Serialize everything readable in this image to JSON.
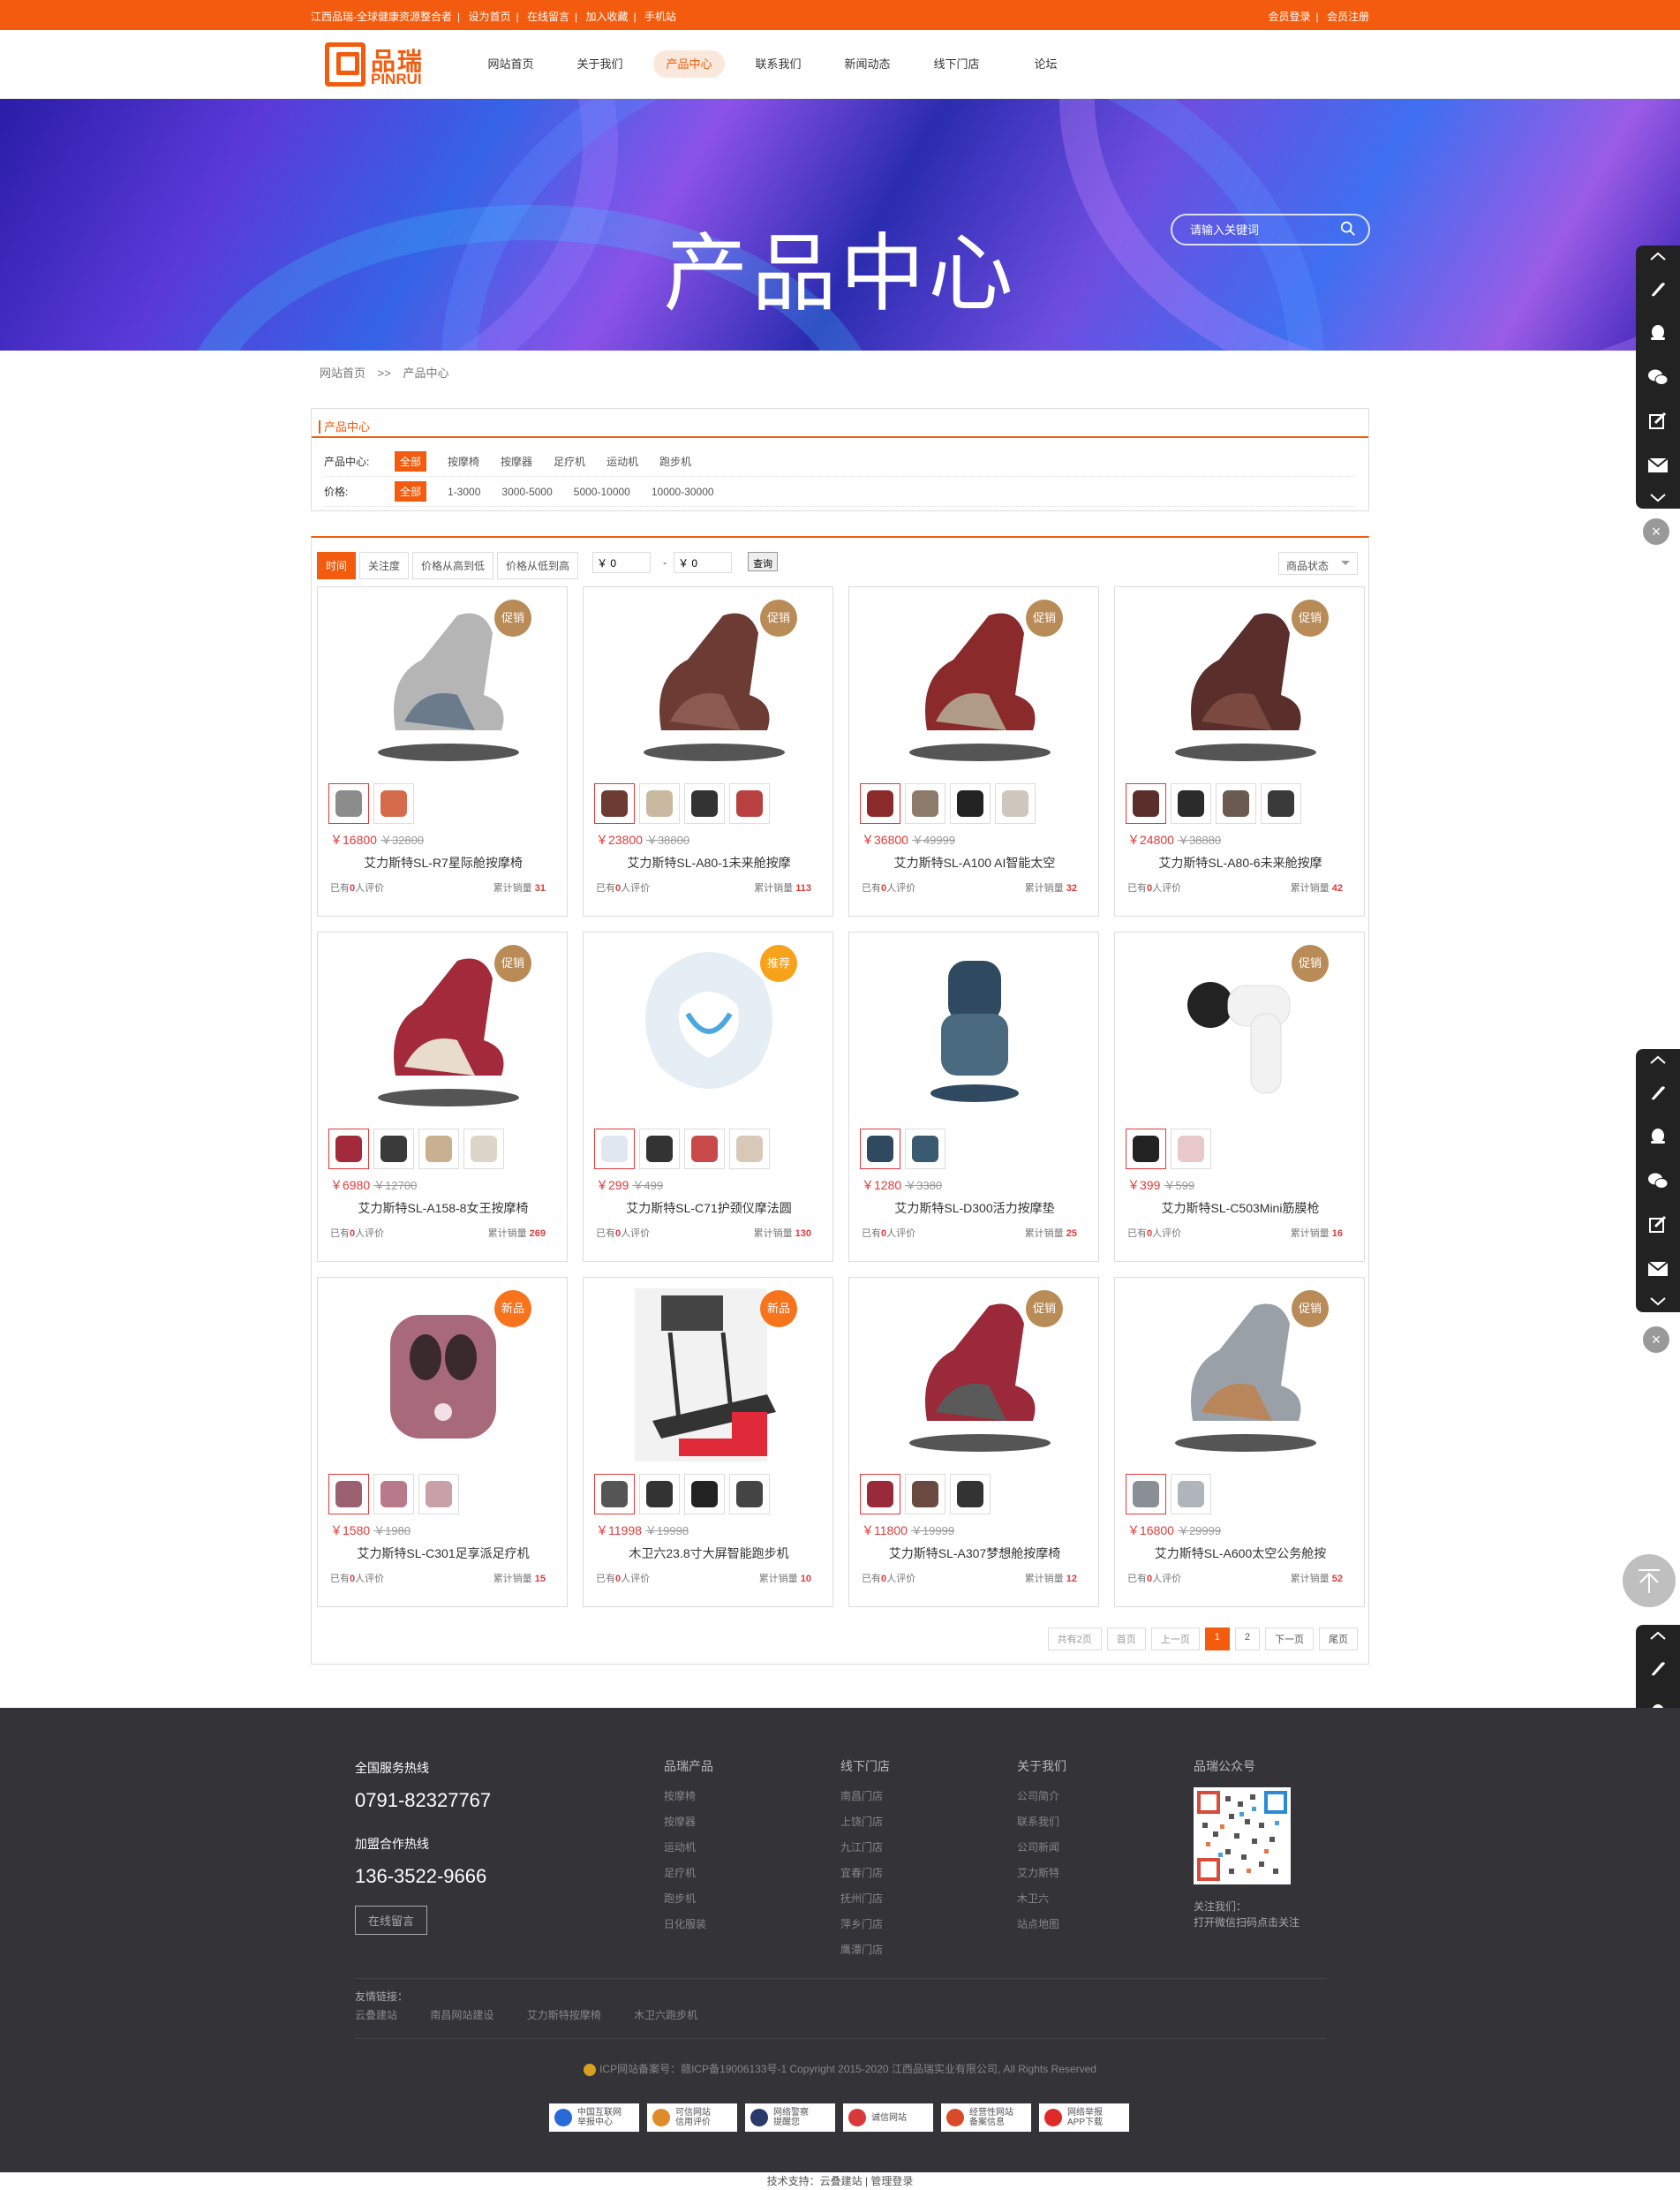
{
  "topbar": {
    "left": [
      "江西品瑞-全球健康资源整合者",
      "设为首页",
      "在线留言",
      "加入收藏",
      "手机站"
    ],
    "right": [
      "会员登录",
      "会员注册"
    ]
  },
  "logo": {
    "cn": "品瑞",
    "en": "PINRUI"
  },
  "nav": [
    "网站首页",
    "关于我们",
    "产品中心",
    "联系我们",
    "新闻动态",
    "线下门店",
    "论坛"
  ],
  "banner": {
    "title": "产品中心",
    "search_placeholder": "请输入关键词"
  },
  "crumb": [
    "网站首页",
    ">>",
    "产品中心"
  ],
  "filter": {
    "title": "产品中心",
    "cat_label": "产品中心:",
    "cats": [
      "全部",
      "按摩椅",
      "按摩器",
      "足疗机",
      "运动机",
      "跑步机"
    ],
    "price_label": "价格:",
    "prices": [
      "全部",
      "1-3000",
      "3000-5000",
      "5000-10000",
      "10000-30000"
    ]
  },
  "sort": {
    "options": [
      "时间",
      "关注度",
      "价格从高到低",
      "价格从低到高"
    ],
    "min": "￥ 0",
    "dash": "-",
    "max": "￥ 0",
    "query": "查询",
    "status": "商品状态"
  },
  "products": [
    {
      "tag": "促销",
      "tagType": "promo",
      "price": "￥16800",
      "old": "￥32800",
      "name": "艾力斯特SL-R7星际舱按摩椅",
      "rev": "已有",
      "revN": "0",
      "revT": "人评价",
      "sales": "累计销量",
      "salesN": "31",
      "thumbs": [
        "#8c8c8c",
        "#d46b4a"
      ],
      "color": "#b5b5b5",
      "accent": "#6b7b8c"
    },
    {
      "tag": "促销",
      "tagType": "promo",
      "price": "￥23800",
      "old": "￥38800",
      "name": "艾力斯特SL-A80-1未来舱按摩",
      "rev": "已有",
      "revN": "0",
      "revT": "人评价",
      "sales": "累计销量",
      "salesN": "113",
      "thumbs": [
        "#6b3b34",
        "#c9b9a0",
        "#333333",
        "#b84040"
      ],
      "color": "#6b3b34",
      "accent": "#8c5a50"
    },
    {
      "tag": "促销",
      "tagType": "promo",
      "price": "￥36800",
      "old": "￥49999",
      "name": "艾力斯特SL-A100 AI智能太空",
      "rev": "已有",
      "revN": "0",
      "revT": "人评价",
      "sales": "累计销量",
      "salesN": "32",
      "thumbs": [
        "#8b2a2a",
        "#8c7a6b",
        "#222222",
        "#cfc7bd"
      ],
      "color": "#8b2a2a",
      "accent": "#b09a88"
    },
    {
      "tag": "促销",
      "tagType": "promo",
      "price": "￥24800",
      "old": "￥38880",
      "name": "艾力斯特SL-A80-6未来舱按摩",
      "rev": "已有",
      "revN": "0",
      "revT": "人评价",
      "sales": "累计销量",
      "salesN": "42",
      "thumbs": [
        "#5a2e2a",
        "#2b2b2b",
        "#6b5a50",
        "#3a3a3a"
      ],
      "color": "#5a2e2a",
      "accent": "#7a4a40"
    },
    {
      "tag": "促销",
      "tagType": "promo",
      "price": "￥6980",
      "old": "￥12700",
      "name": "艾力斯特SL-A158-8女王按摩椅",
      "rev": "已有",
      "revN": "0",
      "revT": "人评价",
      "sales": "累计销量",
      "salesN": "269",
      "thumbs": [
        "#a32a3a",
        "#3a3a3a",
        "#c9b090",
        "#ddd5c8"
      ],
      "color": "#a32a3a",
      "accent": "#e8dccd"
    },
    {
      "tag": "推荐",
      "tagType": "rec",
      "price": "￥299",
      "old": "￥499",
      "name": "艾力斯特SL-C71护颈仪摩法圆",
      "rev": "已有",
      "revN": "0",
      "revT": "人评价",
      "sales": "累计销量",
      "salesN": "130",
      "thumbs": [
        "#dfe8f0",
        "#333333",
        "#c84a4a",
        "#d8c8b8"
      ],
      "color": "#e6eef5",
      "accent": "#4aa8e0"
    },
    {
      "tag": "",
      "tagType": "",
      "price": "￥1280",
      "old": "￥3380",
      "name": "艾力斯特SL-D300活力按摩垫",
      "rev": "已有",
      "revN": "0",
      "revT": "人评价",
      "sales": "累计销量",
      "salesN": "25",
      "thumbs": [
        "#2f4a60",
        "#3a5a70"
      ],
      "color": "#2f4a60",
      "accent": "#4a6a80"
    },
    {
      "tag": "促销",
      "tagType": "promo",
      "price": "￥399",
      "old": "￥599",
      "name": "艾力斯特SL-C503Mini筋膜枪",
      "rev": "已有",
      "revN": "0",
      "revT": "人评价",
      "sales": "累计销量",
      "salesN": "16",
      "thumbs": [
        "#222222",
        "#e8c8c8"
      ],
      "color": "#f2f2f2",
      "accent": "#222222"
    },
    {
      "tag": "新品",
      "tagType": "new",
      "price": "￥1580",
      "old": "￥1980",
      "name": "艾力斯特SL-C301足享派足疗机",
      "rev": "已有",
      "revN": "0",
      "revT": "人评价",
      "sales": "累计销量",
      "salesN": "15",
      "thumbs": [
        "#9a6070",
        "#b87a8a",
        "#c9a0a8"
      ],
      "color": "#a86a7a",
      "accent": "#3a2a2e"
    },
    {
      "tag": "新品",
      "tagType": "new",
      "price": "￥11998",
      "old": "￥19998",
      "name": "木卫六23.8寸大屏智能跑步机",
      "rev": "已有",
      "revN": "0",
      "revT": "人评价",
      "sales": "累计销量",
      "salesN": "10",
      "thumbs": [
        "#555555",
        "#333333",
        "#222222",
        "#444444"
      ],
      "color": "#444444",
      "accent": "#e02a3a"
    },
    {
      "tag": "促销",
      "tagType": "promo",
      "price": "￥11800",
      "old": "￥19999",
      "name": "艾力斯特SL-A307梦想舱按摩椅",
      "rev": "已有",
      "revN": "0",
      "revT": "人评价",
      "sales": "累计销量",
      "salesN": "12",
      "thumbs": [
        "#9a2a3a",
        "#6a4a40",
        "#333333"
      ],
      "color": "#9a2a3a",
      "accent": "#5a5a5a"
    },
    {
      "tag": "促销",
      "tagType": "promo",
      "price": "￥16800",
      "old": "￥29999",
      "name": "艾力斯特SL-A600太空公务舱按",
      "rev": "已有",
      "revN": "0",
      "revT": "人评价",
      "sales": "累计销量",
      "salesN": "52",
      "thumbs": [
        "#8a8f96",
        "#b0b5bb"
      ],
      "color": "#9aa0a8",
      "accent": "#b8865a"
    }
  ],
  "pager": [
    "共有2页",
    "首页",
    "上一页",
    "1",
    "2",
    "下一页",
    "尾页"
  ],
  "footer": {
    "hot_label": "全国服务热线",
    "hot_tel": "0791-82327767",
    "join_label": "加盟合作热线",
    "join_tel": "136-3522-9666",
    "msg_btn": "在线留言",
    "cols": [
      {
        "h": "品瑞产品",
        "items": [
          "按摩椅",
          "按摩器",
          "运动机",
          "足疗机",
          "跑步机",
          "日化服装"
        ]
      },
      {
        "h": "线下门店",
        "items": [
          "南昌门店",
          "上饶门店",
          "九江门店",
          "宜春门店",
          "抚州门店",
          "萍乡门店",
          "鹰潭门店"
        ]
      },
      {
        "h": "关于我们",
        "items": [
          "公司简介",
          "联系我们",
          "公司新闻",
          "艾力斯特",
          "木卫六",
          "站点地图"
        ]
      }
    ],
    "qr_title": "品瑞公众号",
    "qr_cap1": "关注我们：",
    "qr_cap2": "打开微信扫码点击关注",
    "links_label": "友情链接：",
    "links": [
      "云叠建站",
      "南昌网站建设",
      "艾力斯特按摩椅",
      "木卫六跑步机"
    ],
    "copy": "ICP网站备案号：赣ICP备19006133号-1  Copyright 2015-2020 江西品瑞实业有限公司, All Rights Reserved",
    "badges": [
      [
        "中国互联网",
        "举报中心"
      ],
      [
        "可信网站",
        "信用评价"
      ],
      [
        "网络警察",
        "提醒您"
      ],
      [
        "诚信网站",
        ""
      ],
      [
        "经营性网站",
        "备案信息"
      ],
      [
        "网络举报",
        "APP下载"
      ]
    ],
    "bottom": "技术支持：云叠建站 | 管理登录"
  },
  "colors": {
    "accent": "#f35b0f",
    "price": "#e03a3a",
    "footer_bg": "#333338"
  }
}
